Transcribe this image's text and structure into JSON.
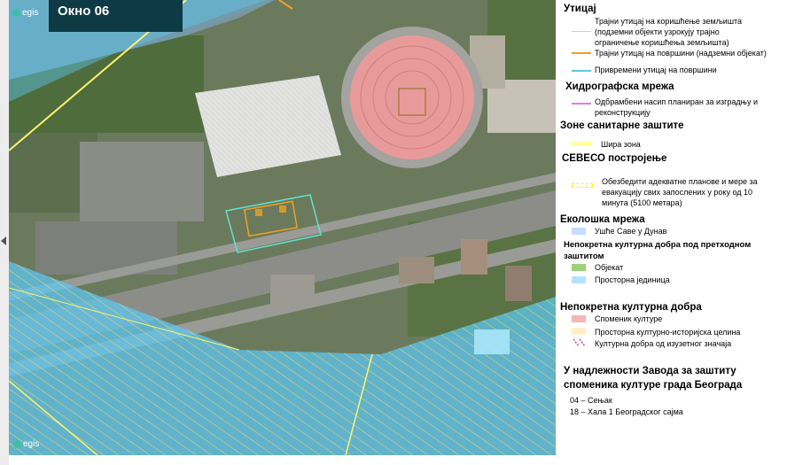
{
  "window": {
    "title": "Окно 06",
    "logo_text": "egis",
    "logo_bottom_text": "egis"
  },
  "colors": {
    "title_bg": "#0e3a45",
    "sports_hall_dome": "#e89a9a",
    "cultural_unit_zone": "#5cc7f0",
    "heritage_monument": "#f4b6b6",
    "permanent_surface_impact": "#f0a01e",
    "temporary_surface_impact": "#5fc9e8",
    "flood_embankment": "#e07de0",
    "sanitary_zone": "#ffff66",
    "seveso": "#ffee00",
    "ecological_network": "#c6dbff",
    "cultural_object": "#9ad17a",
    "cultural_spatial_unit": "#b3e3fb",
    "historic_spatial_unit": "#fff0c8",
    "exceptional_significance": "#c040c0"
  },
  "legend": {
    "impact": {
      "heading": "Утицај",
      "permanent_land_use": "Трајни утицај на коришћење земљишта",
      "permanent_land_use_2": "(подземни објекти узрокују трајно",
      "permanent_land_use_3": "ограничење коришћења земљишта)",
      "permanent_surface": "Трајни утицај на површини (надземни објекат)",
      "temporary_surface": "Привремени утицај на површини"
    },
    "hydro": {
      "heading": "Хидрографска мрежа",
      "embankment": "Одбрамбени насип планиран за изградњу и",
      "embankment_2": "реконструкцију"
    },
    "sanitary": {
      "heading": "Зоне санитарне заштите",
      "wide_zone": "Шира зона"
    },
    "seveso": {
      "heading": "СЕВЕСО постројење",
      "note": "Обезбедити адекватне планове и мере за",
      "note_2": "евакуацију  свих запослених у року од 10",
      "note_3": "минута (5100 метара)"
    },
    "eco": {
      "heading": "Еколошка мрежа",
      "sava_danube": "Ушће Саве у Дунав"
    },
    "protected": {
      "heading": "Непокретна културна добра под претходном",
      "heading_2": "заштитом",
      "object": "Објекат",
      "spatial_unit": "Просторна јединица"
    },
    "cultural": {
      "heading": "Непокретна културна добра",
      "monument": "Споменик културе",
      "historic_unit": "Просторна културно-историјска целина",
      "exceptional": "Културна добра од изузетног значаја"
    },
    "institute": {
      "heading": "У надлежности Завода за заштиту",
      "heading_2": "споменика  културе града Београда",
      "item_04": "04 – Сењак",
      "item_18": "18 – Хала 1 Београдског сајма"
    }
  }
}
